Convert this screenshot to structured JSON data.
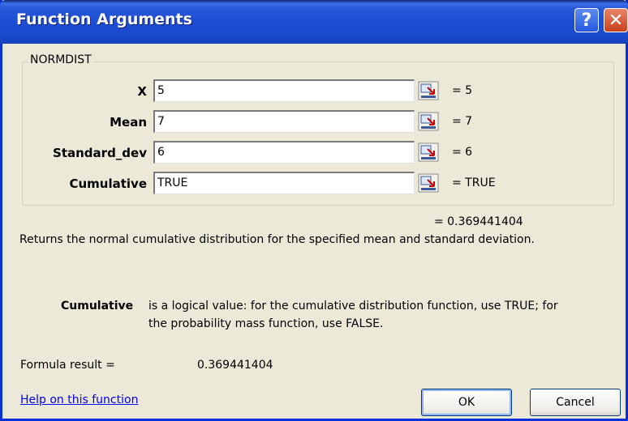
{
  "window": {
    "title": "Function Arguments"
  },
  "function": {
    "name": "NORMDIST",
    "args": [
      {
        "label": "X",
        "value": "5",
        "result": "= 5"
      },
      {
        "label": "Mean",
        "value": "7",
        "result": "= 7"
      },
      {
        "label": "Standard_dev",
        "value": "6",
        "result": "= 6"
      },
      {
        "label": "Cumulative",
        "value": "TRUE",
        "result": "= TRUE"
      }
    ],
    "result_line": "= 0.369441404",
    "description": "Returns the normal cumulative distribution for the specified mean and standard deviation.",
    "arg_help_name": "Cumulative",
    "arg_help_text_1": "is a logical value: for the cumulative distribution function, use TRUE; for",
    "arg_help_text_2": "the probability mass function, use FALSE."
  },
  "footer": {
    "formula_result_label": "Formula result =",
    "formula_result_value": "0.369441404",
    "help_link": "Help on this function",
    "ok_label": "OK",
    "cancel_label": "Cancel"
  },
  "icons": {
    "help": "help-question-icon",
    "close": "close-x-icon",
    "collapse": "collapse-dialog-icon"
  },
  "colors": {
    "titlebar": "#2857d8",
    "close": "#c8401c",
    "link": "#0000ee",
    "background": "#ece9d8"
  }
}
